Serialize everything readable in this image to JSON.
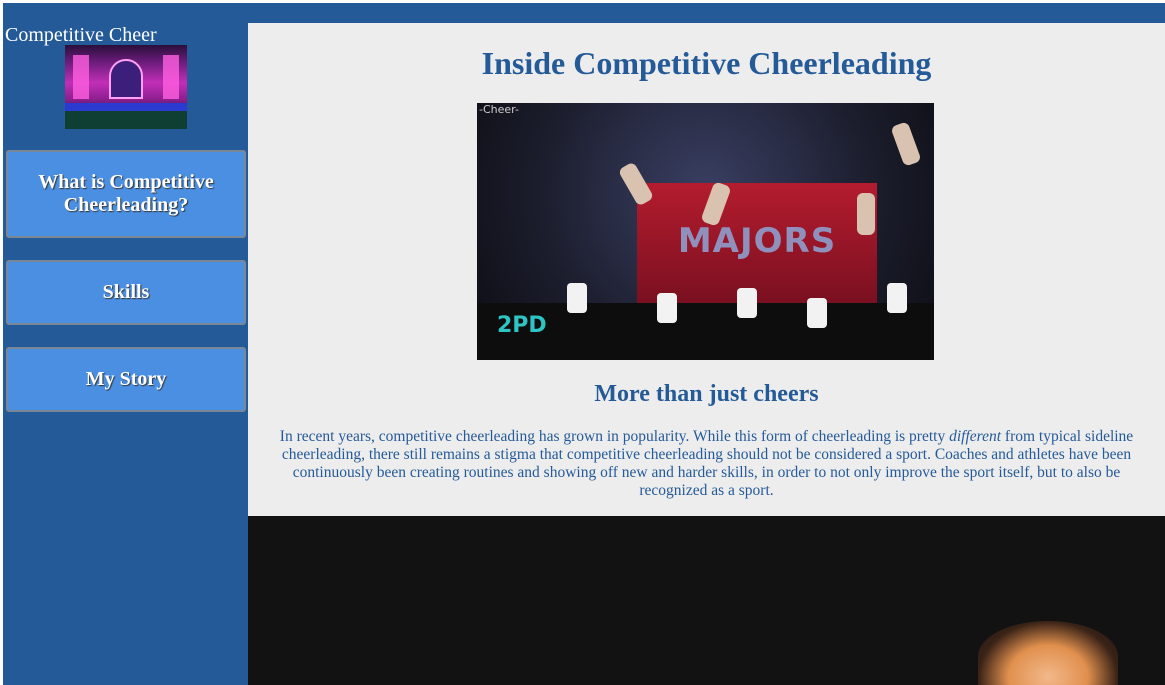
{
  "site": {
    "title": "Competitive Cheer"
  },
  "sidebar": {
    "items": [
      {
        "label": "What is Competitive Cheerleading?"
      },
      {
        "label": "Skills"
      },
      {
        "label": "My Story"
      }
    ]
  },
  "main": {
    "heading": "Inside Competitive Cheerleading",
    "hero": {
      "corner_tag": "-Cheer-",
      "sign_text": "MAJORS",
      "watermark": "2PD"
    },
    "subheading": "More than just cheers",
    "paragraph_before": "In recent years, competitive cheerleading has grown in popularity. While this form of cheerleading is pretty ",
    "paragraph_emphasis": "different",
    "paragraph_after": " from typical sideline cheerleading, there still remains a stigma that competitive cheerleading should not be considered a sport. Coaches and athletes have been continuously been creating routines and showing off new and harder skills, in order to not only improve the sport itself, but to also be recognized as a sport."
  },
  "colors": {
    "brand_blue": "#255a98",
    "button_blue": "#4b8fe2",
    "content_bg": "#ededed"
  }
}
